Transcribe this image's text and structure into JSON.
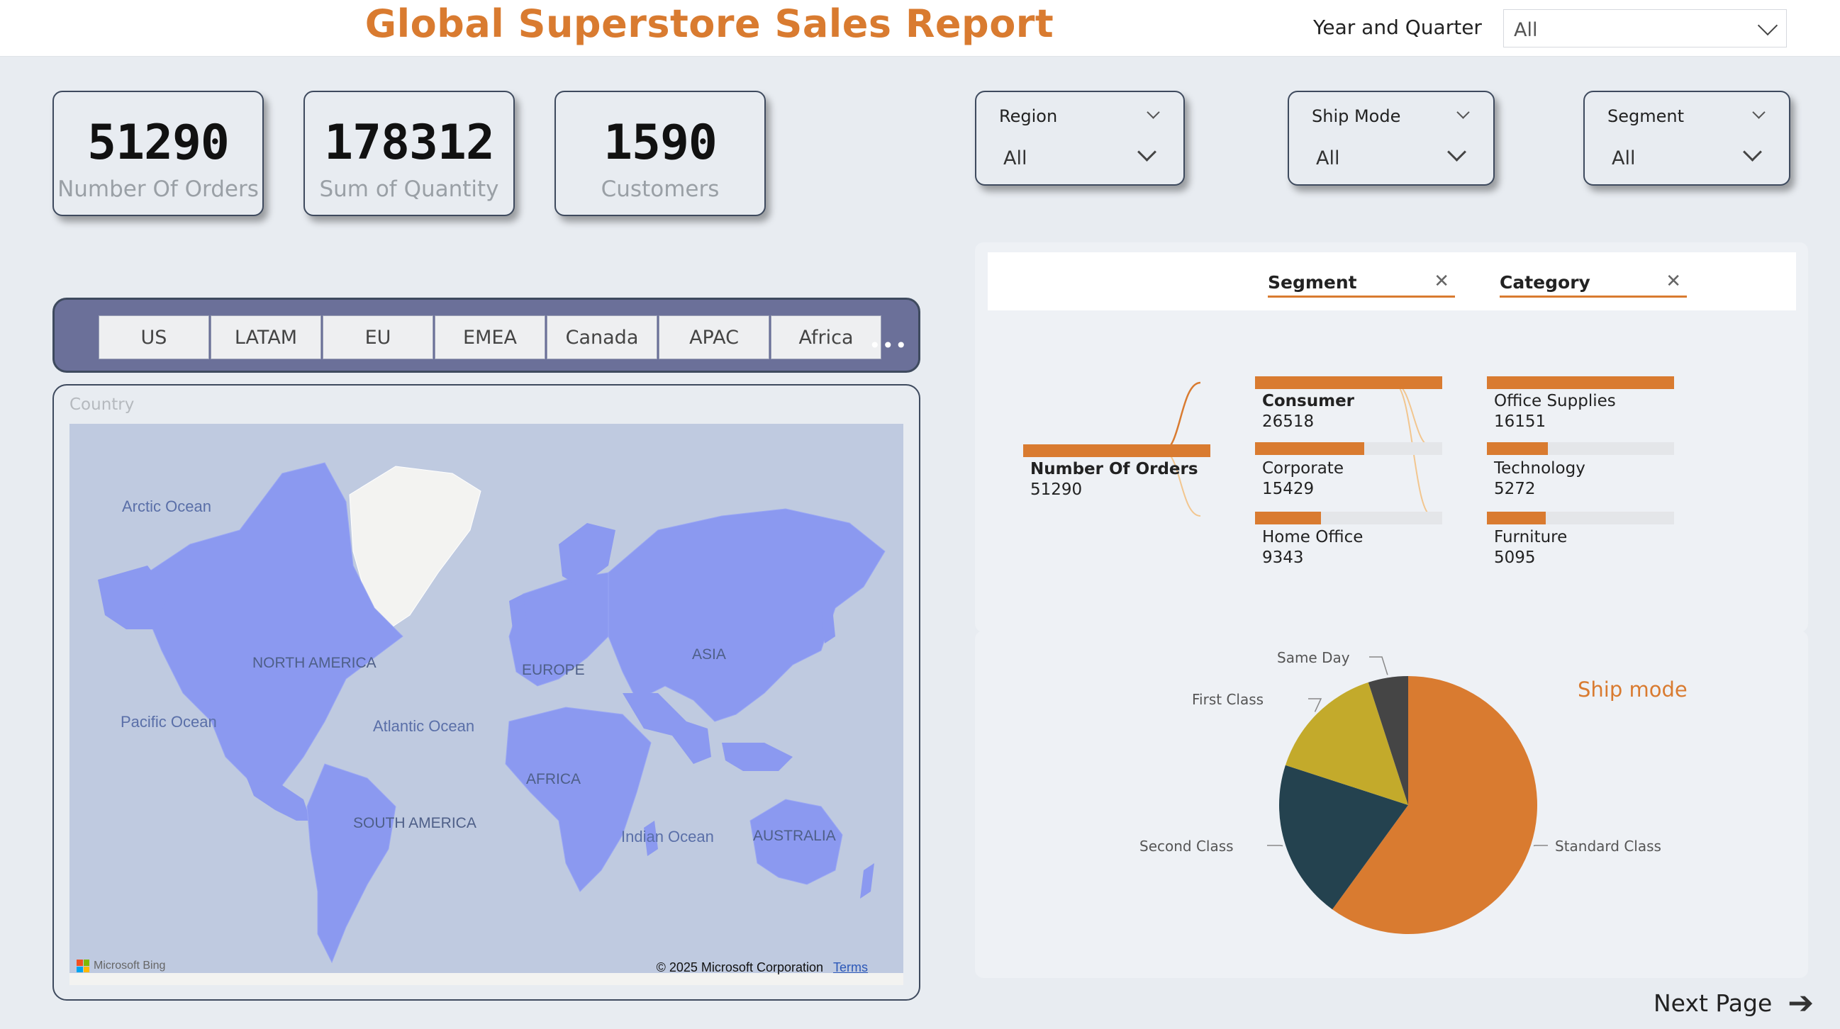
{
  "header": {
    "title": "Global Superstore Sales Report",
    "year_quarter_label": "Year and Quarter",
    "year_quarter_value": "All"
  },
  "kpis": [
    {
      "value": "51290",
      "label": "Number Of Orders"
    },
    {
      "value": "178312",
      "label": "Sum of Quantity"
    },
    {
      "value": "1590",
      "label": "Customers"
    }
  ],
  "slicers": [
    {
      "title": "Region",
      "value": "All"
    },
    {
      "title": "Ship Mode",
      "value": "All"
    },
    {
      "title": "Segment",
      "value": "All"
    }
  ],
  "region_buttons": [
    "US",
    "LATAM",
    "EU",
    "EMEA",
    "Canada",
    "APAC",
    "Africa"
  ],
  "map": {
    "title": "Country",
    "continents": [
      "NORTH AMERICA",
      "SOUTH AMERICA",
      "EUROPE",
      "AFRICA",
      "ASIA",
      "AUSTRALIA"
    ],
    "oceans": [
      "Arctic Ocean",
      "Pacific Ocean",
      "Atlantic Ocean",
      "Indian Ocean"
    ],
    "attribution": "Microsoft Bing",
    "copyright": "© 2025 Microsoft Corporation",
    "terms": "Terms",
    "colors": {
      "land_highlight": "#8b99f0",
      "land_other": "#f3f3f1",
      "water": "#bfcae0"
    }
  },
  "decomposition": {
    "levels": [
      "Segment",
      "Category"
    ],
    "close_icon": "close-icon",
    "root": {
      "label": "Number Of Orders",
      "value": 51290
    },
    "segment_nodes": [
      {
        "label": "Consumer",
        "value": 26518
      },
      {
        "label": "Corporate",
        "value": 15429
      },
      {
        "label": "Home Office",
        "value": 9343
      }
    ],
    "category_nodes": [
      {
        "label": "Office Supplies",
        "value": 16151
      },
      {
        "label": "Technology",
        "value": 5272
      },
      {
        "label": "Furniture",
        "value": 5095
      }
    ],
    "colors": {
      "bar": "#d97b30",
      "track": "#e4e6e9",
      "link_active": "#d97b30",
      "link_muted": "#f2c68f"
    }
  },
  "ship_mode_chart": {
    "title": "Ship mode"
  },
  "chart_data": {
    "type": "pie",
    "title": "Ship mode",
    "categories": [
      "Standard Class",
      "Second Class",
      "First Class",
      "Same Day"
    ],
    "values": [
      60,
      20,
      15,
      5
    ],
    "colors": [
      "#d97b30",
      "#24424f",
      "#c3aa2b",
      "#454545"
    ]
  },
  "footer": {
    "next_page_label": "Next Page"
  }
}
